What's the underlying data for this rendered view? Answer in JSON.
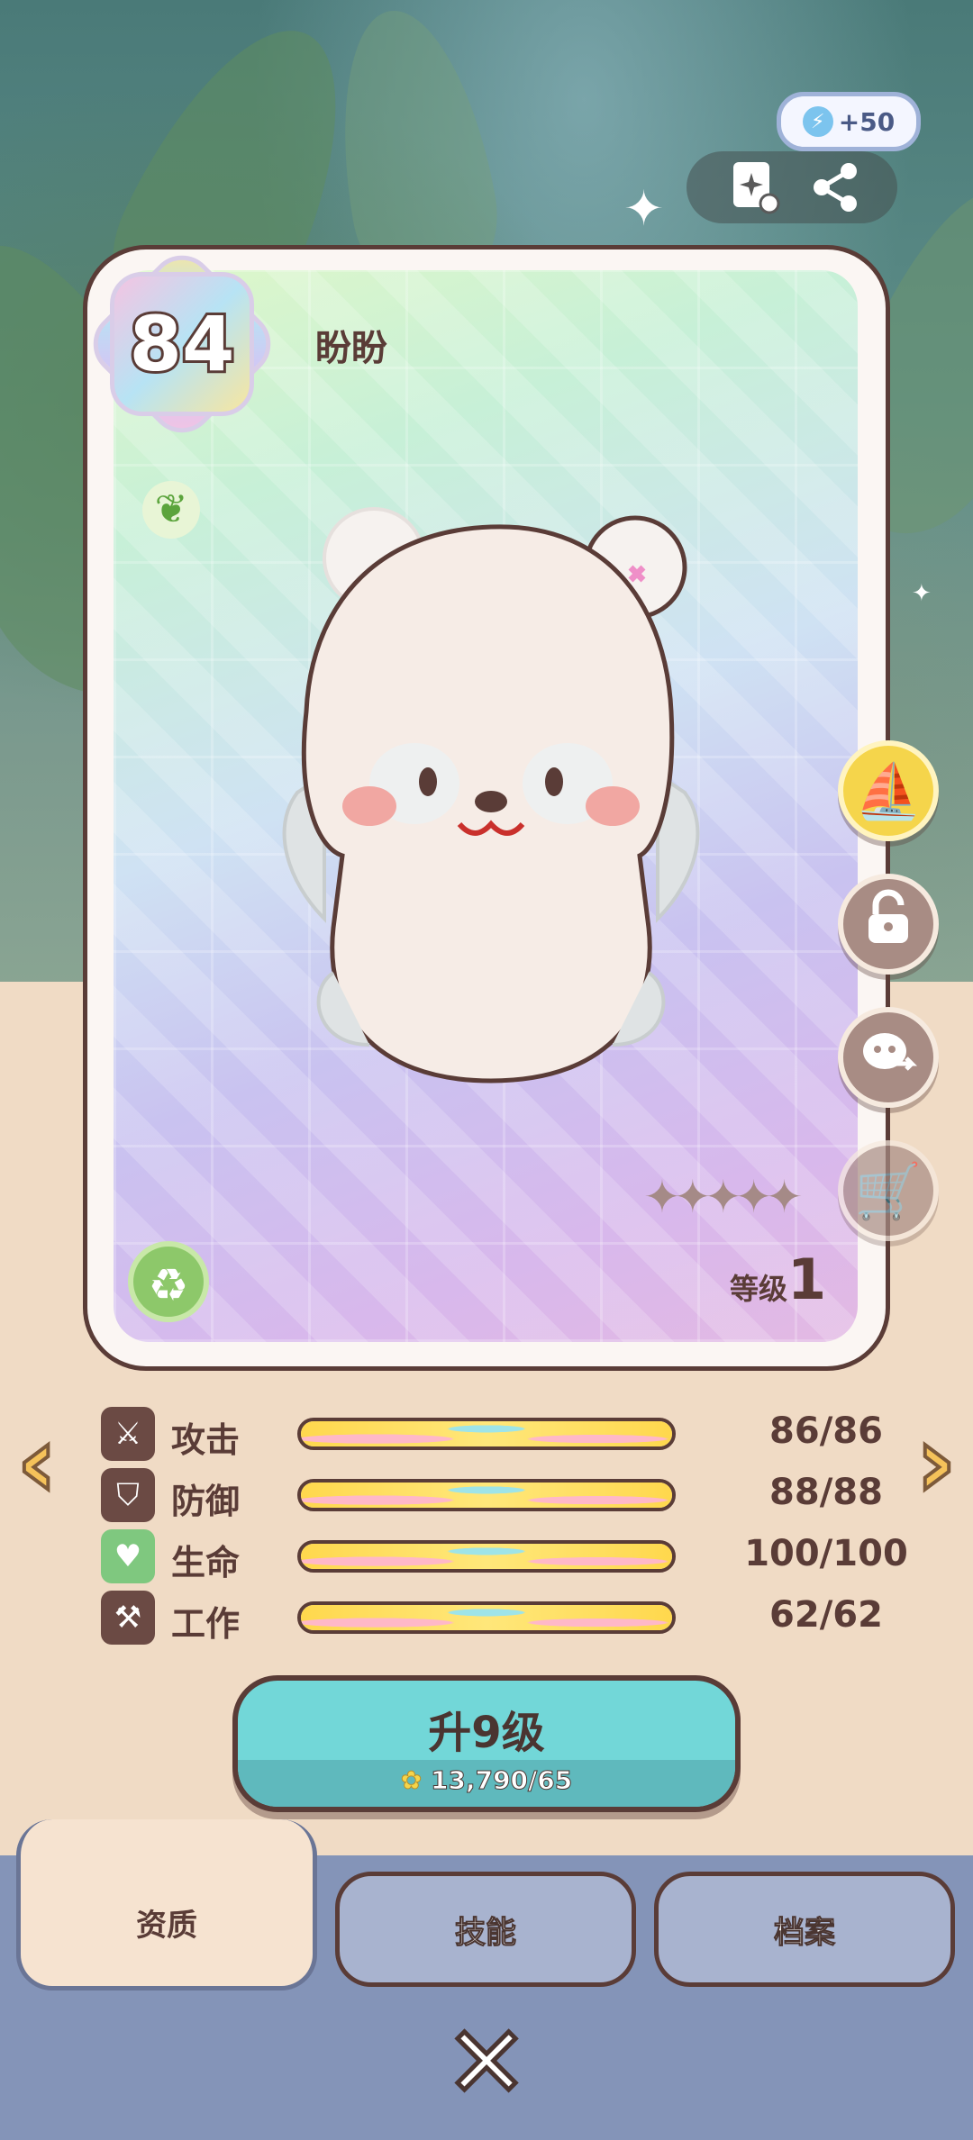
{
  "energy": {
    "value": "+50",
    "icon": "lightning-icon"
  },
  "card": {
    "rank": "84",
    "name": "盼盼",
    "level_label": "等级",
    "level_value": "1",
    "stars_count": 5
  },
  "side_buttons": [
    "boat-icon",
    "lock-icon",
    "transfer-icon",
    "cart-icon"
  ],
  "stats": [
    {
      "label": "攻击",
      "value": "86/86",
      "fill": 1.0,
      "icon": "sword-icon"
    },
    {
      "label": "防御",
      "value": "88/88",
      "fill": 1.0,
      "icon": "shield-icon"
    },
    {
      "label": "生命",
      "value": "100/100",
      "fill": 1.0,
      "icon": "heart-icon"
    },
    {
      "label": "工作",
      "value": "62/62",
      "fill": 1.0,
      "icon": "hammer-icon"
    }
  ],
  "upgrade": {
    "title": "升9级",
    "cost": "13,790/65"
  },
  "tabs": [
    "资质",
    "技能",
    "档案"
  ],
  "colors": {
    "accent": "#72d7d8",
    "outline": "#5a3c37",
    "footer": "#8494b8"
  }
}
